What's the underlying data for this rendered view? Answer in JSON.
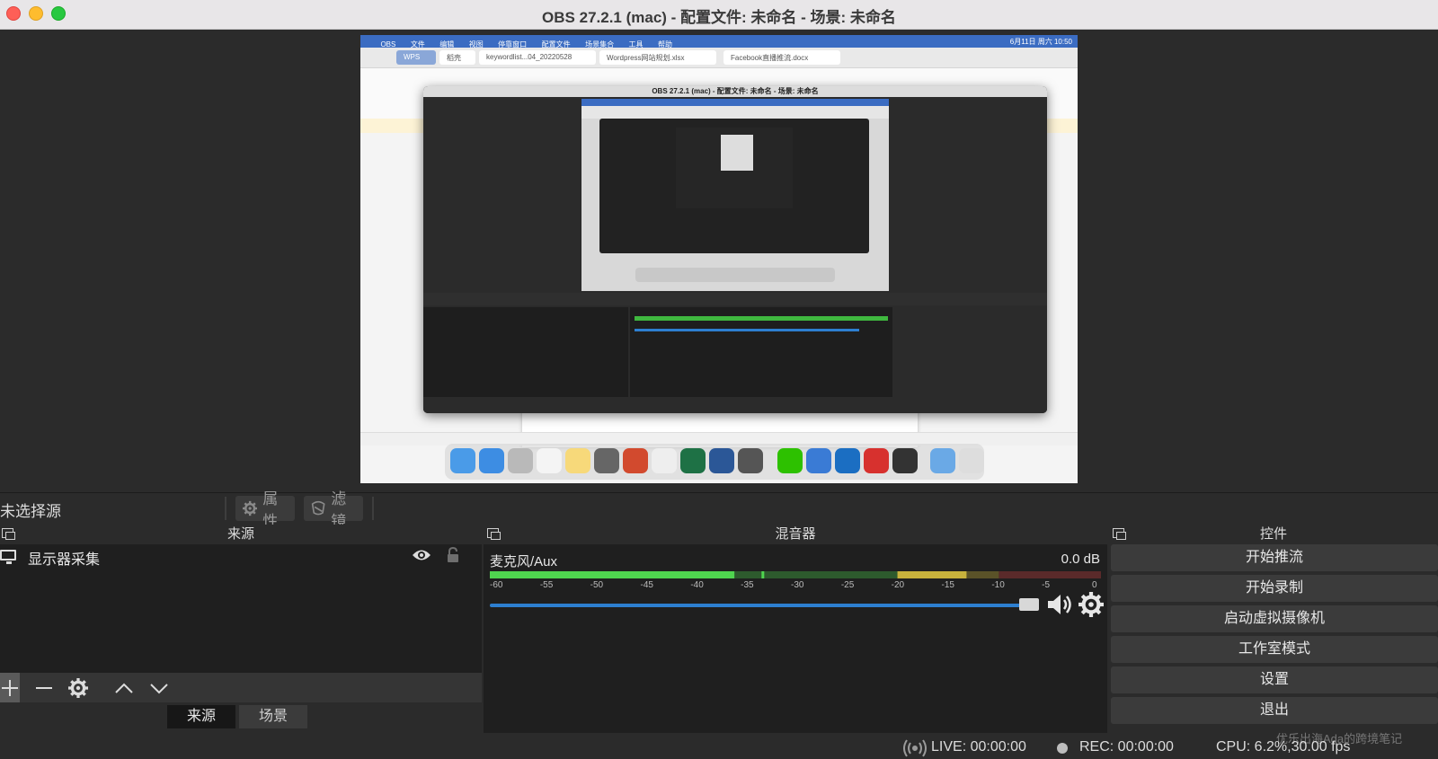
{
  "window": {
    "title": "OBS 27.2.1 (mac) - 配置文件: 未命名 - 场景: 未命名"
  },
  "preview": {
    "inner_title": "OBS 27.2.1 (mac) - 配置文件: 未命名 - 场景: 未命名",
    "wps_tabs": [
      "WPS",
      "稻壳",
      "keywordlist...04_20220528",
      "Wordpress网站规划.xlsx",
      "Facebook直播推流.docx"
    ],
    "menubar": [
      "OBS",
      "文件",
      "编辑",
      "视图",
      "停靠窗口",
      "配置文件",
      "场景集合",
      "工具",
      "帮助"
    ],
    "menubar_time": "6月11日 周六 10:50"
  },
  "context_bar": {
    "label": "未选择源",
    "properties_label": "属性",
    "filters_label": "滤镜"
  },
  "sources": {
    "header": "来源",
    "items": [
      {
        "name": "显示器采集",
        "visible_icon": "eye-icon",
        "lock_icon": "lock-icon"
      }
    ],
    "tabs": [
      "来源",
      "场景"
    ]
  },
  "mixer": {
    "header": "混音器",
    "channel_name": "麦克风/Aux",
    "level_db": "0.0 dB",
    "scale": [
      "-60",
      "-55",
      "-50",
      "-45",
      "-40",
      "-35",
      "-30",
      "-25",
      "-20",
      "-15",
      "-10",
      "-5",
      "0"
    ],
    "meter_level_fraction": 0.78,
    "fader_fraction": 0.98,
    "colors": {
      "green": "#4fd44f",
      "yellow": "#c8b23c",
      "red": "#c24343",
      "fader": "#2d7fd0"
    }
  },
  "controls": {
    "header": "控件",
    "buttons": [
      "开始推流",
      "开始录制",
      "启动虚拟摄像机",
      "工作室模式",
      "设置",
      "退出"
    ]
  },
  "status": {
    "live": "LIVE: 00:00:00",
    "rec": "REC: 00:00:00",
    "cpu": "CPU: 6.2%,30.00 fps"
  },
  "watermark": "优乐出海Ada的跨境笔记"
}
